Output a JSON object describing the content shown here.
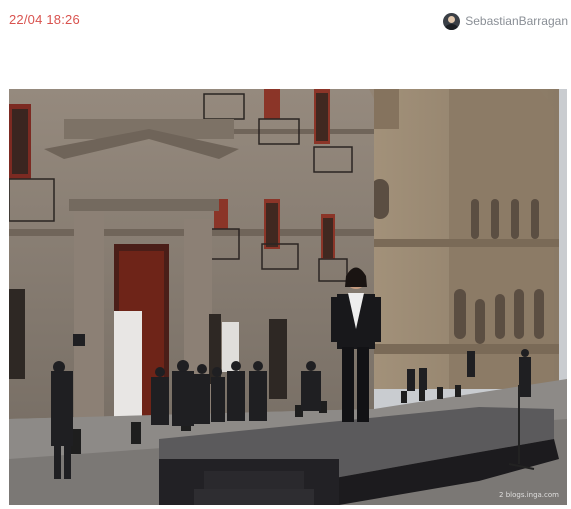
{
  "post": {
    "timestamp": "22/04 18:26",
    "author": {
      "name": "SebastianBarragan",
      "avatar_icon": "user-avatar-icon"
    }
  },
  "photo": {
    "watermark": "2 blogs.inga.com"
  },
  "colors": {
    "timestamp": "#d9534f",
    "author_name": "#8a8f96"
  }
}
